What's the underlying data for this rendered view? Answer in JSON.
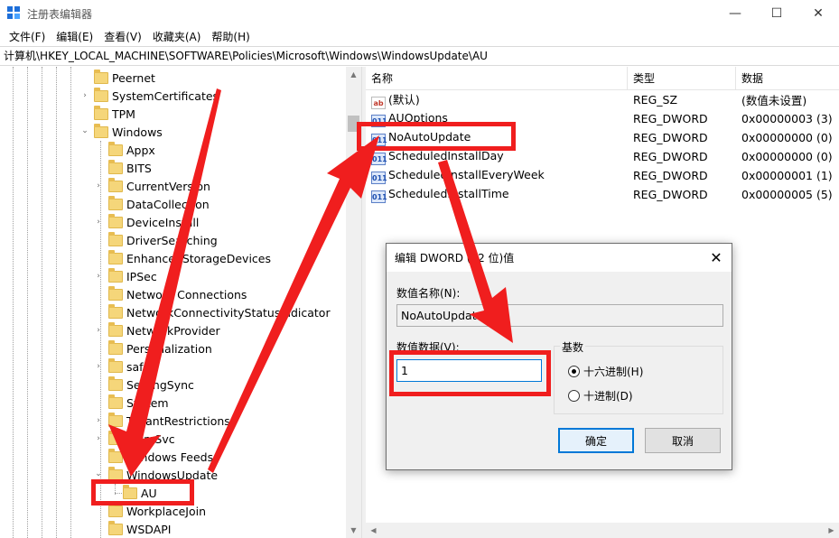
{
  "window": {
    "title": "注册表编辑器",
    "minimize": "—",
    "maximize": "☐",
    "close": "✕"
  },
  "menu": [
    "文件(F)",
    "编辑(E)",
    "查看(V)",
    "收藏夹(A)",
    "帮助(H)"
  ],
  "address": "计算机\\HKEY_LOCAL_MACHINE\\SOFTWARE\\Policies\\Microsoft\\Windows\\WindowsUpdate\\AU",
  "tree": {
    "level1": [
      {
        "label": "Peernet",
        "expander": ""
      },
      {
        "label": "SystemCertificates",
        "expander": "›"
      },
      {
        "label": "TPM",
        "expander": ""
      },
      {
        "label": "Windows",
        "expander": "⌄"
      }
    ],
    "windows_children": [
      {
        "label": "Appx",
        "expander": ""
      },
      {
        "label": "BITS",
        "expander": ""
      },
      {
        "label": "CurrentVersion",
        "expander": "›"
      },
      {
        "label": "DataCollection",
        "expander": ""
      },
      {
        "label": "DeviceInstall",
        "expander": "›"
      },
      {
        "label": "DriverSearching",
        "expander": ""
      },
      {
        "label": "EnhancedStorageDevices",
        "expander": ""
      },
      {
        "label": "IPSec",
        "expander": "›"
      },
      {
        "label": "Network Connections",
        "expander": ""
      },
      {
        "label": "NetworkConnectivityStatusIndicator",
        "expander": ""
      },
      {
        "label": "NetworkProvider",
        "expander": "›"
      },
      {
        "label": "Personalization",
        "expander": ""
      },
      {
        "label": "safer",
        "expander": "›"
      },
      {
        "label": "SettingSync",
        "expander": ""
      },
      {
        "label": "System",
        "expander": ""
      },
      {
        "label": "TenantRestrictions",
        "expander": "›"
      },
      {
        "label": "WcmSvc",
        "expander": "›"
      },
      {
        "label": "Windows Feeds",
        "expander": ""
      },
      {
        "label": "WindowsUpdate",
        "expander": "⌄"
      }
    ],
    "au": {
      "label": "AU"
    },
    "after": [
      {
        "label": "WorkplaceJoin",
        "expander": ""
      },
      {
        "label": "WSDAPI",
        "expander": ""
      }
    ]
  },
  "list": {
    "headers": {
      "name": "名称",
      "type": "类型",
      "data": "数据"
    },
    "rows": [
      {
        "icon": "ab",
        "name": "(默认)",
        "type": "REG_SZ",
        "data": "(数值未设置)"
      },
      {
        "icon": "011",
        "name": "AUOptions",
        "type": "REG_DWORD",
        "data": "0x00000003 (3)"
      },
      {
        "icon": "011",
        "name": "NoAutoUpdate",
        "type": "REG_DWORD",
        "data": "0x00000000 (0)"
      },
      {
        "icon": "011",
        "name": "ScheduledInstallDay",
        "type": "REG_DWORD",
        "data": "0x00000000 (0)"
      },
      {
        "icon": "011",
        "name": "ScheduledInstallEveryWeek",
        "type": "REG_DWORD",
        "data": "0x00000001 (1)"
      },
      {
        "icon": "011",
        "name": "ScheduledInstallTime",
        "type": "REG_DWORD",
        "data": "0x00000005 (5)"
      }
    ]
  },
  "dialog": {
    "title": "编辑 DWORD (32 位)值",
    "close": "✕",
    "name_label": "数值名称(N):",
    "name_value": "NoAutoUpdate",
    "data_label": "数值数据(V):",
    "data_value": "1",
    "base_label": "基数",
    "hex_label": "十六进制(H)",
    "dec_label": "十进制(D)",
    "ok": "确定",
    "cancel": "取消"
  },
  "colors": {
    "annotation": "#f01e1e",
    "accent": "#0078d7"
  }
}
